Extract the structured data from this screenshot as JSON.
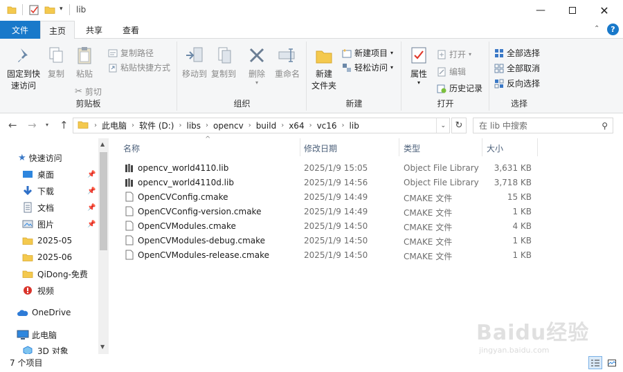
{
  "window": {
    "title": "lib"
  },
  "tabs": [
    "文件",
    "主页",
    "共享",
    "查看"
  ],
  "ribbon": {
    "clipboard": {
      "label": "剪贴板",
      "pin": "固定到快\n速访问",
      "copy": "复制",
      "paste": "粘贴",
      "copy_path": "复制路径",
      "paste_shortcut": "粘贴快捷方式",
      "cut": "剪切"
    },
    "organize": {
      "label": "组织",
      "move_to": "移动到",
      "copy_to": "复制到",
      "delete": "删除",
      "rename": "重命名"
    },
    "new": {
      "label": "新建",
      "new_folder": "新建\n文件夹",
      "new_item": "新建项目",
      "easy_access": "轻松访问"
    },
    "open": {
      "label": "打开",
      "properties": "属性",
      "open": "打开",
      "edit": "编辑",
      "history": "历史记录"
    },
    "select": {
      "label": "选择",
      "select_all": "全部选择",
      "select_none": "全部取消",
      "invert": "反向选择"
    }
  },
  "address": {
    "crumbs": [
      "此电脑",
      "软件 (D:)",
      "libs",
      "opencv",
      "build",
      "x64",
      "vc16",
      "lib"
    ]
  },
  "search": {
    "placeholder": "在 lib 中搜索"
  },
  "nav": {
    "quick_access": "快速访问",
    "items": [
      {
        "label": "桌面",
        "icon": "desktop-icon",
        "pinned": true
      },
      {
        "label": "下载",
        "icon": "download-icon",
        "pinned": true
      },
      {
        "label": "文档",
        "icon": "document-icon",
        "pinned": true
      },
      {
        "label": "图片",
        "icon": "picture-icon",
        "pinned": true
      },
      {
        "label": "2025-05",
        "icon": "folder-icon",
        "pinned": false
      },
      {
        "label": "2025-06",
        "icon": "folder-icon",
        "pinned": false
      },
      {
        "label": "QiDong-免费",
        "icon": "folder-icon",
        "pinned": false
      },
      {
        "label": "视频",
        "icon": "video-icon",
        "pinned": false
      }
    ],
    "onedrive": "OneDrive",
    "this_pc": "此电脑",
    "objects3d": "3D 对象"
  },
  "columns": {
    "name": "名称",
    "date": "修改日期",
    "type": "类型",
    "size": "大小"
  },
  "files": [
    {
      "name": "opencv_world4110.lib",
      "date": "2025/1/9 15:05",
      "type": "Object File Library",
      "size": "3,631 KB",
      "icon": "lib"
    },
    {
      "name": "opencv_world4110d.lib",
      "date": "2025/1/9 14:56",
      "type": "Object File Library",
      "size": "3,718 KB",
      "icon": "lib"
    },
    {
      "name": "OpenCVConfig.cmake",
      "date": "2025/1/9 14:49",
      "type": "CMAKE 文件",
      "size": "15 KB",
      "icon": "doc"
    },
    {
      "name": "OpenCVConfig-version.cmake",
      "date": "2025/1/9 14:49",
      "type": "CMAKE 文件",
      "size": "1 KB",
      "icon": "doc"
    },
    {
      "name": "OpenCVModules.cmake",
      "date": "2025/1/9 14:50",
      "type": "CMAKE 文件",
      "size": "4 KB",
      "icon": "doc"
    },
    {
      "name": "OpenCVModules-debug.cmake",
      "date": "2025/1/9 14:50",
      "type": "CMAKE 文件",
      "size": "1 KB",
      "icon": "doc"
    },
    {
      "name": "OpenCVModules-release.cmake",
      "date": "2025/1/9 14:50",
      "type": "CMAKE 文件",
      "size": "1 KB",
      "icon": "doc"
    }
  ],
  "status": {
    "count": "7 个项目"
  },
  "watermark": {
    "brand": "Baidu经验",
    "url": "jingyan.baidu.com"
  },
  "colors": {
    "accent": "#1979ca",
    "folder": "#f4c94e",
    "header_text": "#4c607a"
  }
}
